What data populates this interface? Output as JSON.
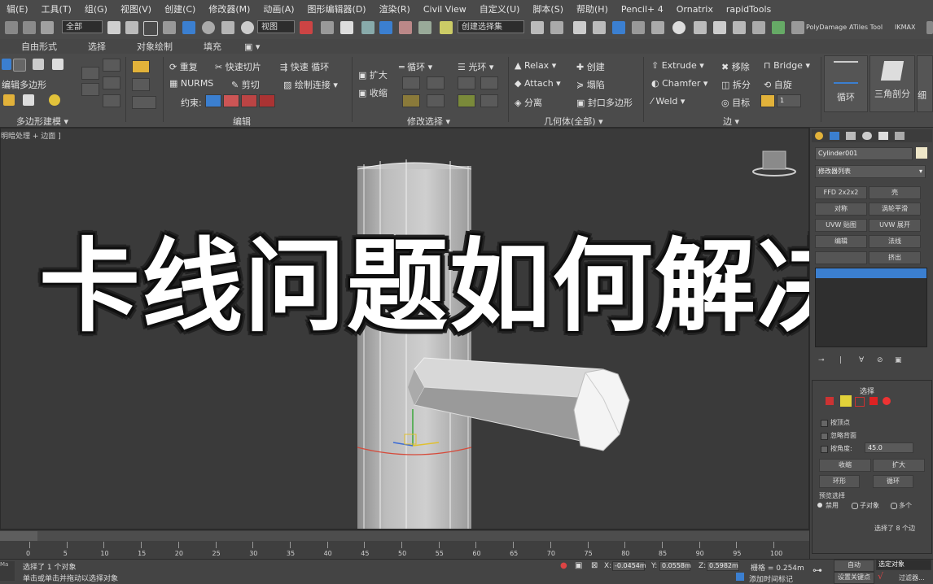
{
  "menu": [
    "辑(E)",
    "工具(T)",
    "组(G)",
    "视图(V)",
    "创建(C)",
    "修改器(M)",
    "动画(A)",
    "图形编辑器(D)",
    "渲染(R)",
    "Civil View",
    "自定义(U)",
    "脚本(S)",
    "帮助(H)",
    "Pencil+ 4",
    "Ornatrix",
    "rapidTools"
  ],
  "toolbar": {
    "filter_value": "全部",
    "view_value": "视图",
    "selset_value": "创建选择集",
    "plugin_polydamage": "PolyDamage",
    "plugin_atiles": "ATiles Tool",
    "plugin_ikmax": "IKMAX"
  },
  "ribbon_tabs": [
    "自由形式",
    "选择",
    "对象绘制",
    "填充"
  ],
  "ribbon": {
    "left": {
      "edit_poly": "编辑多边形",
      "footer": "多边形建模 ▾"
    },
    "edit": {
      "repeat": "重复",
      "quickslice": "快速切片",
      "quickloop": "快速 循环",
      "nurms": "NURMS",
      "cut": "剪切",
      "paintconnect": "绘制连接",
      "constraint": "约束:",
      "footer": "编辑"
    },
    "modsel": {
      "grow": "扩大",
      "shrink": "收缩",
      "loop": "循环",
      "ring": "光环",
      "footer": "修改选择 ▾"
    },
    "geom": {
      "relax": "Relax",
      "create": "创建",
      "attach": "Attach",
      "collapse": "塌陷",
      "detach": "分离",
      "cap": "封口多边形",
      "footer": "几何体(全部) ▾"
    },
    "edges": {
      "extrude": "Extrude",
      "remove": "移除",
      "bridge": "Bridge",
      "chamfer": "Chamfer",
      "split": "拆分",
      "spin": "自旋",
      "weld": "Weld",
      "target": "目标",
      "target_val": "1",
      "footer": "边 ▾"
    },
    "big": {
      "loop": "循环",
      "tri": "三角剖分",
      "fine": "细"
    }
  },
  "viewport": {
    "label": "[+] [透视] [用户定义] [明暗处理 + 边面]",
    "label_short": "明暗处理 + 边面 ]"
  },
  "title": "卡线问题如何解决",
  "cmd": {
    "object_name": "Cylinder001",
    "modlist": "修改器列表",
    "buttons": [
      "FFD 2x2x2",
      "壳",
      "对称",
      "涡轮平滑",
      "UVW 贴图",
      "UVW 展开",
      "编辑",
      "法线",
      "",
      "挤出"
    ],
    "rollout_select": "选择",
    "by_vertex": "按顶点",
    "ignore_back": "忽略背面",
    "by_angle": "按角度:",
    "angle_val": "45.0",
    "shrink": "收缩",
    "grow": "扩大",
    "ring": "环形",
    "loop": "循环",
    "preview": "预览选择",
    "disabled": "禁用",
    "subobj": "子对象",
    "multi": "多个",
    "selected_count": "选择了 8 个边"
  },
  "timeline": {
    "frame": "100",
    "ticks": [
      "0",
      "5",
      "10",
      "15",
      "20",
      "25",
      "30",
      "35",
      "40",
      "45",
      "50",
      "55",
      "60",
      "65",
      "70",
      "75",
      "80",
      "85",
      "90",
      "95",
      "100"
    ]
  },
  "status": {
    "selected": "选择了 1 个对象",
    "hint": "单击或单击并拖动以选择对象",
    "x_label": "X:",
    "x_val": "-0.0454m",
    "y_label": "Y:",
    "y_val": "0.0558m",
    "z_label": "Z:",
    "z_val": "0.5982m",
    "grid": "栅格 = 0.254m",
    "auto": "自动",
    "selobj": "选定对象",
    "setkey": "设置关键点",
    "filter": "过滤器...",
    "addtime": "添加时间标记",
    "script_label": "Ma"
  },
  "colors": {
    "accent_blue": "#3b7fd0",
    "viewport_bg": "#3a3a3a",
    "panel_bg": "#4b4b4b"
  }
}
